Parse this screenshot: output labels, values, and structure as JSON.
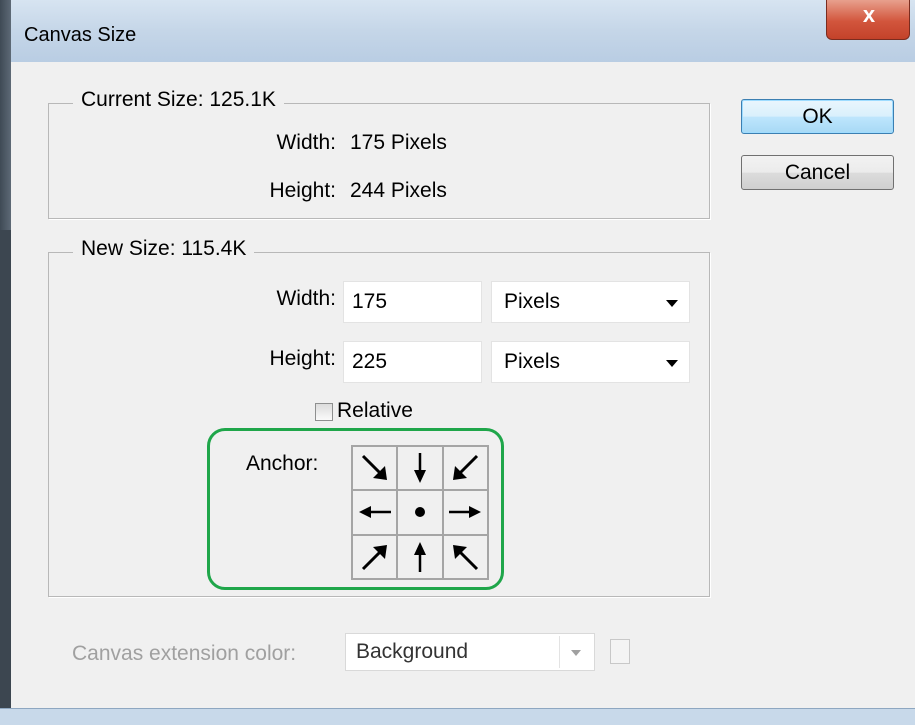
{
  "window": {
    "title": "Canvas Size",
    "close_glyph": "x"
  },
  "buttons": {
    "ok": "OK",
    "cancel": "Cancel"
  },
  "current_size": {
    "legend": "Current Size: 125.1K",
    "width_label": "Width:",
    "width_value": "175 Pixels",
    "height_label": "Height:",
    "height_value": "244 Pixels"
  },
  "new_size": {
    "legend": "New Size: 115.4K",
    "width_label": "Width:",
    "width_value": "175",
    "width_unit": "Pixels",
    "height_label": "Height:",
    "height_value": "225",
    "height_unit": "Pixels",
    "relative_label": "Relative",
    "relative_checked": false,
    "anchor_label": "Anchor:",
    "anchor_cells": [
      "arrow-down-right-icon",
      "arrow-down-icon",
      "arrow-down-left-icon",
      "arrow-right-icon",
      "center-dot-icon",
      "arrow-left-icon",
      "arrow-up-right-icon",
      "arrow-up-icon",
      "arrow-up-left-icon"
    ]
  },
  "extension": {
    "label": "Canvas extension color:",
    "value": "Background",
    "enabled": false
  },
  "colors": {
    "highlight": "#1fa64a",
    "default_button_border": "#3c7fb1",
    "close_button": "#c3422a"
  }
}
